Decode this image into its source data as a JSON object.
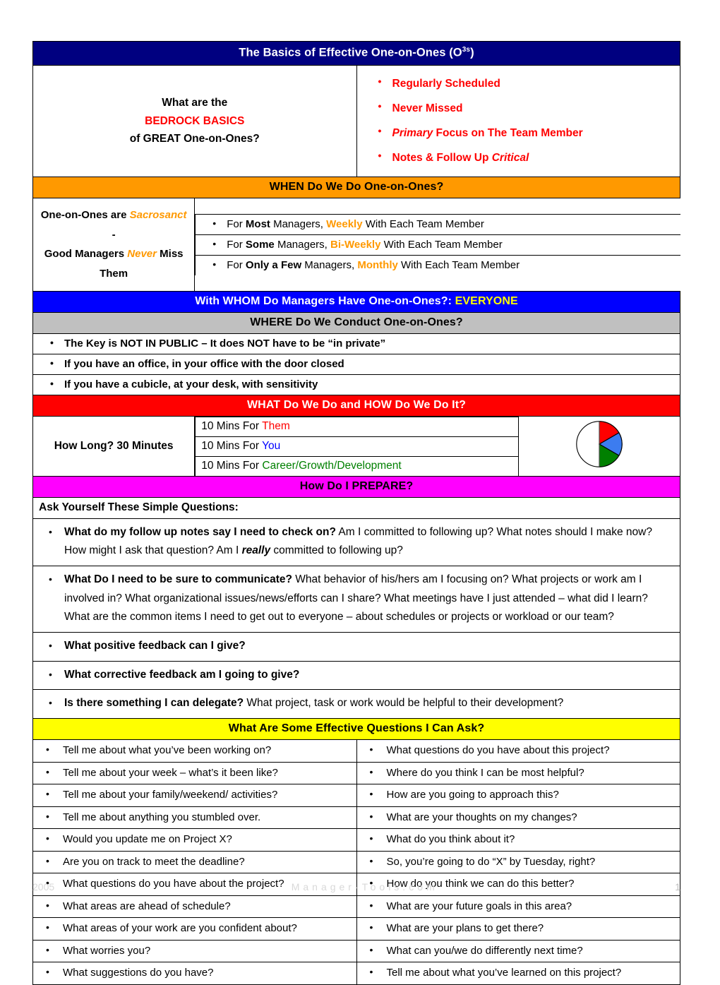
{
  "title": {
    "main": "The Basics of Effective One-on-Ones (O",
    "sup": "3s",
    "close": ")"
  },
  "bedrock": {
    "line1": "What are the",
    "line2": "BEDROCK BASICS",
    "line3": "of GREAT One-on-Ones?",
    "bullets": [
      {
        "plain": "Regularly Scheduled",
        "italic_lead": "",
        "italic_tail": ""
      },
      {
        "plain": "Never Missed",
        "italic_lead": "",
        "italic_tail": ""
      },
      {
        "plain": " Focus on The Team Member",
        "italic_lead": "Primary",
        "italic_tail": ""
      },
      {
        "plain": "Notes & Follow Up ",
        "italic_lead": "",
        "italic_tail": "Critical"
      }
    ]
  },
  "when": {
    "header": "WHEN Do We Do One-on-Ones?",
    "left_line1_a": "One-on-Ones are ",
    "left_line1_b": "Sacrosanct",
    "left_line1_c": " -",
    "left_line2_a": "Good Managers ",
    "left_line2_b": "Never",
    "left_line2_c": " Miss Them",
    "rows": [
      {
        "pre": "For ",
        "bold": "Most",
        "mid": " Managers, ",
        "hl": "Weekly",
        "post": " With Each Team Member"
      },
      {
        "pre": "For ",
        "bold": "Some",
        "mid": " Managers, ",
        "hl": "Bi-Weekly",
        "post": " With Each Team Member"
      },
      {
        "pre": "For ",
        "bold": "Only a Few",
        "mid": " Managers, ",
        "hl": "Monthly",
        "post": " With Each Team Member"
      }
    ]
  },
  "whom": {
    "text": "With WHOM Do Managers Have One-on-Ones?: ",
    "highlight": "EVERYONE"
  },
  "where": {
    "header": "WHERE Do We Conduct One-on-Ones?",
    "rows": [
      "The Key is NOT IN PUBLIC – It does NOT have to be “in private”",
      "If you have an office, in your office with the door closed",
      "If you have a cubicle, at your desk, with sensitivity"
    ]
  },
  "what": {
    "header": "WHAT Do We Do and HOW Do We Do It?",
    "how_long": "How Long?  30 Minutes",
    "mins": [
      {
        "pre": "10 Mins For ",
        "who": "Them",
        "color": "#FF0000"
      },
      {
        "pre": "10 Mins For ",
        "who": "You",
        "color": "#0000FF"
      },
      {
        "pre": "10 Mins For ",
        "who": "Career/Growth/Development",
        "color": "#008000"
      }
    ],
    "pie": {
      "slices": [
        {
          "label": "Them",
          "color": "#FF0000",
          "percent": 16.7
        },
        {
          "label": "You",
          "color": "#3C7CF0",
          "percent": 16.7
        },
        {
          "label": "Career/Growth/Development",
          "color": "#008000",
          "percent": 16.7
        },
        {
          "label": "Unallocated",
          "color": "#FFFFFF",
          "percent": 50
        }
      ]
    }
  },
  "prepare": {
    "header": "How Do I PREPARE?",
    "ask": "Ask Yourself These Simple Questions:",
    "items": [
      {
        "bold": "What do my follow up notes say I need to check on?",
        "rest_a": " Am I committed to following up?   What notes should I make now?  How might I ask that question?  Am I ",
        "bold_italic": "really",
        "rest_b": " committed to following up?"
      },
      {
        "bold": "What Do I need to be sure to communicate?",
        "rest_a": " What behavior of his/hers am I focusing on?  What projects or work am I involved in?  What organizational issues/news/efforts can I share?  What meetings have I just attended – what did I learn?  What are the common items I need to get out to everyone – about schedules or projects or workload or our team?",
        "bold_italic": "",
        "rest_b": ""
      },
      {
        "bold": "What positive feedback can I give?",
        "rest_a": "",
        "bold_italic": "",
        "rest_b": ""
      },
      {
        "bold": "What corrective feedback am I going to give?",
        "rest_a": "",
        "bold_italic": "",
        "rest_b": ""
      },
      {
        "bold": "Is there something I can delegate?",
        "rest_a": "  What project, task or work would be helpful to their development?",
        "bold_italic": "",
        "rest_b": ""
      }
    ]
  },
  "questions": {
    "header": "What Are Some Effective Questions I Can Ask?",
    "left": [
      "Tell me about what you’ve been working on?",
      "Tell me about your week – what’s it been like?",
      "Tell me about your family/weekend/ activities?",
      "Tell me about anything you stumbled over.",
      "Would you update me on Project X?",
      "Are you on track to meet the deadline?",
      "What questions do you have about the project?",
      "What areas are ahead of schedule?",
      "What areas of your work are you confident about?",
      "What worries you?",
      "What suggestions do you have?"
    ],
    "right": [
      "What questions do you have about this project?",
      "Where do you think I can be most helpful?",
      "How are you going to approach this?",
      "What are your thoughts on my changes?",
      "What do you think about it?",
      "So, you’re going to do “X” by Tuesday, right?",
      "How do you think we can do this better?",
      "What are your future goals in this area?",
      "What are your plans to get there?",
      "What can you/we do differently next time?",
      "Tell me about what you’ve learned on this project?"
    ]
  },
  "footer": {
    "year": "2005",
    "site": "Manager-Tools.com",
    "page": "1"
  }
}
